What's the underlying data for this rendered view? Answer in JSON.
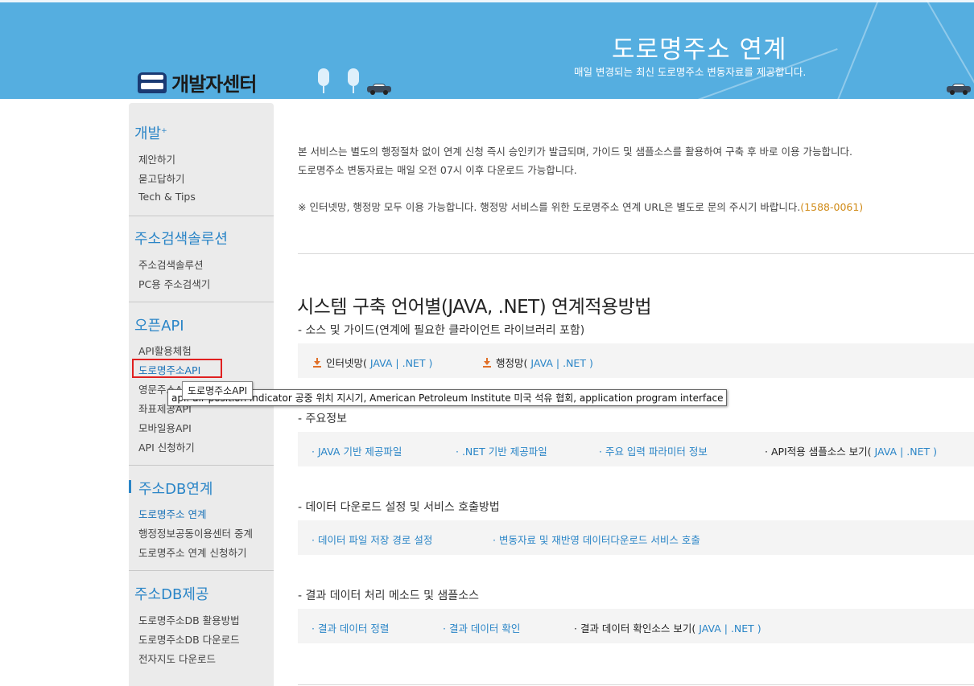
{
  "header": {
    "logo_text": "개발자센터",
    "hero_title": "도로명주소 연계",
    "hero_subtitle": "매일 변경되는 최신 도로명주소 변동자료를 제공합니다."
  },
  "sidebar": {
    "dev": {
      "title": "개발",
      "title_mark": "+",
      "items": [
        "제안하기",
        "묻고답하기",
        "Tech & Tips"
      ]
    },
    "search": {
      "title": "주소검색솔루션",
      "items": [
        "주소검색솔루션",
        "PC용 주소검색기"
      ]
    },
    "openapi": {
      "title": "오픈API",
      "items": [
        "API활용체험",
        "도로명주소API",
        "영문주소API",
        "좌표제공API",
        "모바일용API",
        "API 신청하기"
      ]
    },
    "dblink": {
      "title": "주소DB연계",
      "items": [
        "도로명주소 연계",
        "행정정보공동이용센터 중계",
        "도로명주소 연계 신청하기"
      ]
    },
    "dbprov": {
      "title": "주소DB제공",
      "items": [
        "도로명주소DB 활용방법",
        "도로명주소DB 다운로드",
        "전자지도 다운로드"
      ]
    }
  },
  "tooltips": {
    "item": "도로명주소API",
    "glossary": "api: air position indicator 공중 위치 지시기, American Petroleum Institute 미국 석유 협회, application program interface"
  },
  "intro": {
    "line1": "본 서비스는 별도의 행정절차 없이 연계 신청 즉시 승인키가 발급되며, 가이드 및 샘플소스를 활용하여 구축 후 바로 이용 가능합니다.",
    "line2": "도로명주소 변동자료는 매일 오전 07시 이후 다운로드 가능합니다.",
    "line3": "※ 인터넷망, 행정망 모두 이용 가능합니다. 행정망 서비스를 위한 도로명주소 연계 URL은 별도로 문의 주시기 바랍니다.",
    "phone": "(1588-0061)"
  },
  "section": {
    "title": "시스템 구축 언어별(JAVA, .NET) 연계적용방법",
    "source": {
      "heading": "- 소스 및 가이드(연계에 필요한 클라이언트 라이브러리 포함)",
      "internet_label": "인터넷망(",
      "gov_label": "행정망(",
      "java": "JAVA",
      "net": ".NET",
      "sep": "|",
      "close": ")"
    },
    "info": {
      "heading": "- 주요정보",
      "links": [
        "· JAVA 기반 제공파일",
        "· .NET 기반 제공파일",
        "· 주요 입력 파라미터 정보"
      ],
      "sample_label": "· API적용 샘플소스 보기(",
      "java": "JAVA",
      "net": ".NET",
      "sep": "|",
      "close": ")"
    },
    "download": {
      "heading": "- 데이터 다운로드 설정 및 서비스 호출방법",
      "links": [
        "· 데이터 파일 저장 경로 설정",
        "· 변동자료 및 재반영 데이터다운로드 서비스 호출"
      ]
    },
    "result": {
      "heading": "- 결과 데이터 처리 메소드 및 샘플소스",
      "links": [
        "· 결과 데이터 정렬",
        "· 결과 데이터 확인"
      ],
      "sample_label": "· 결과 데이터 확인소스 보기(",
      "java": "JAVA",
      "net": ".NET",
      "sep": "|",
      "close": ")"
    }
  },
  "colors": {
    "header_bg": "#55aee0",
    "accent": "#2a85c7",
    "highlight": "#e02020",
    "phone": "#d08a16"
  }
}
